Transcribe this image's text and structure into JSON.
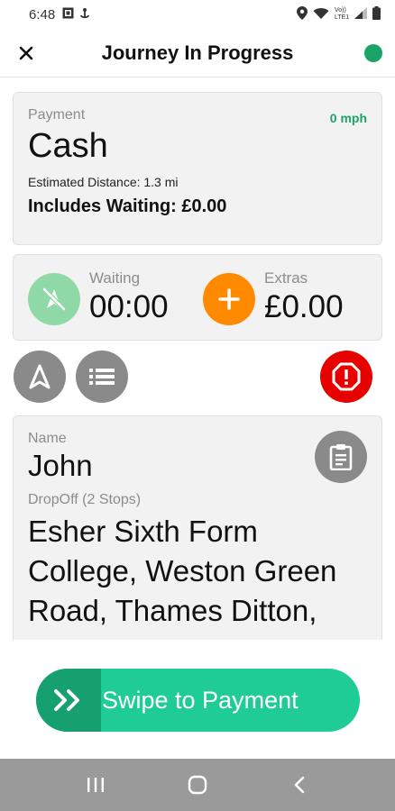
{
  "status_bar": {
    "time": "6:48",
    "network_label": "Vo)) LTE1"
  },
  "header": {
    "title": "Journey In Progress",
    "status_color": "#1aa468"
  },
  "payment": {
    "label": "Payment",
    "speed": "0 mph",
    "method": "Cash",
    "distance": "Estimated Distance: 1.3 mi",
    "waiting_included": "Includes Waiting: £0.00"
  },
  "waiting": {
    "label": "Waiting",
    "value": "00:00",
    "icon": "slashed-navigation-icon",
    "color": "#8fd9a7"
  },
  "extras": {
    "label": "Extras",
    "value": "£0.00",
    "icon": "plus-icon",
    "color": "#ff8a00"
  },
  "actions": {
    "navigate_icon": "navigation-arrow-icon",
    "list_icon": "list-icon",
    "alert_icon": "alert-icon",
    "alert_color": "#e60000"
  },
  "passenger": {
    "name_label": "Name",
    "name": "John",
    "dropoff_label": "DropOff (2 Stops)",
    "dropoff_address": "Esher Sixth Form College, Weston Green Road, Thames Ditton,"
  },
  "swipe": {
    "label": "Swipe to Payment",
    "color": "#20cc96"
  }
}
